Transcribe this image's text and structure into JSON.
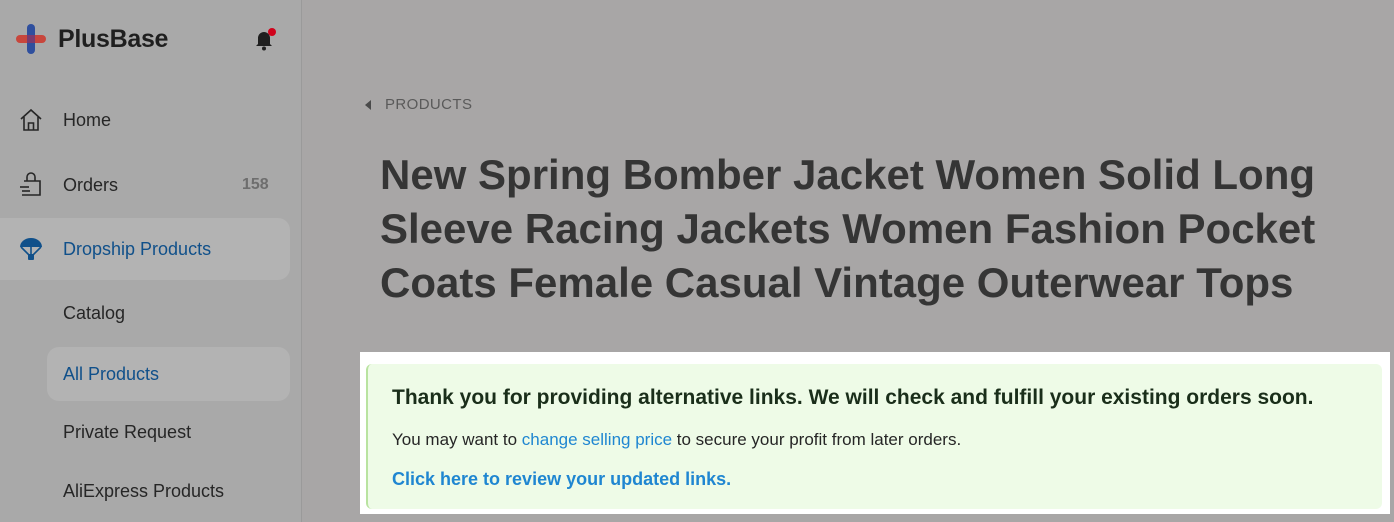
{
  "brand": {
    "name": "PlusBase"
  },
  "sidebar": {
    "items": [
      {
        "label": "Home"
      },
      {
        "label": "Orders",
        "count": "158"
      },
      {
        "label": "Dropship Products"
      }
    ],
    "sub_items": [
      {
        "label": "Catalog"
      },
      {
        "label": "All Products"
      },
      {
        "label": "Private Request"
      },
      {
        "label": "AliExpress Products"
      }
    ]
  },
  "main": {
    "breadcrumb": "PRODUCTS",
    "title": "New Spring Bomber Jacket Women Solid Long Sleeve Racing Jackets Women Fashion Pocket Coats Female Casual Vintage Outerwear Tops"
  },
  "alert": {
    "title": "Thank you for providing alternative links. We will check and fulfill your existing orders soon.",
    "body_prefix": "You may want to ",
    "body_link": "change selling price",
    "body_suffix": " to secure your profit from later orders.",
    "review_link": "Click here to review your updated links."
  },
  "colors": {
    "accent": "#1f86d1",
    "active_nav": "#10508a",
    "alert_bg": "#eefbe7",
    "notification_dot": "#d0021b"
  }
}
